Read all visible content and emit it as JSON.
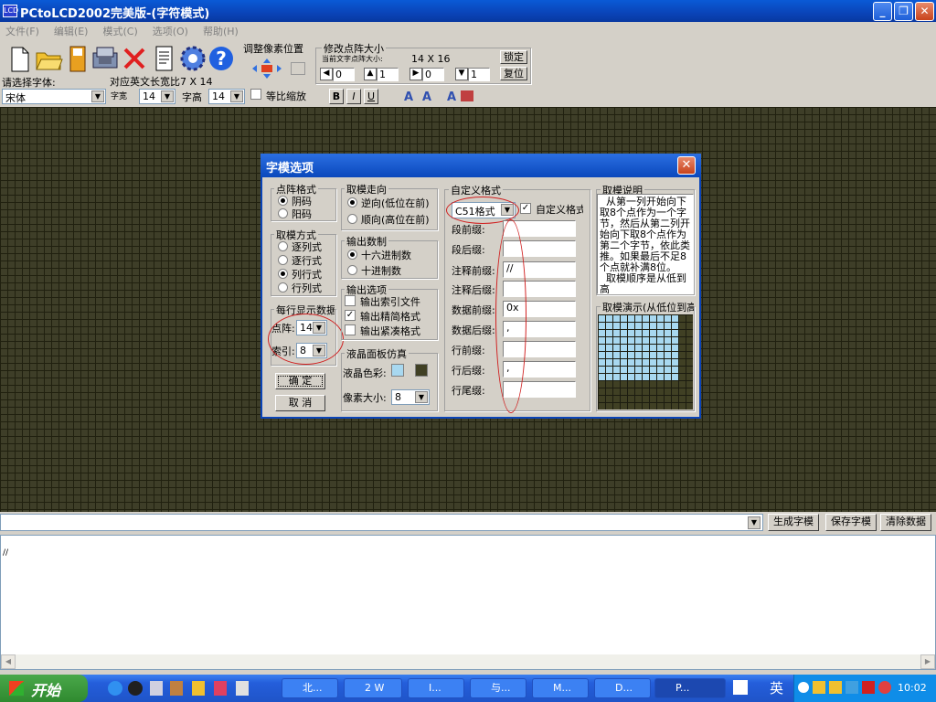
{
  "window": {
    "title": "PCtoLCD2002完美版-(字符模式)",
    "minimize": "_",
    "restore": "❐",
    "close": "✕"
  },
  "menu": [
    "文件(F)",
    "编辑(E)",
    "模式(C)",
    "选项(O)",
    "帮助(H)"
  ],
  "toolbar": {
    "adjust_pixel_label": "调整像素位置",
    "modify_size_label": "修改点阵大小",
    "current_size_label": "当前文字点阵大小:",
    "current_size_value": "14 X 16",
    "lock_button": "锁定",
    "reset_button": "复位",
    "spin1": "0",
    "spin2": "1",
    "spin3": "0",
    "spin4": "1",
    "font_select_label": "请选择字体:",
    "ratio_label": "对应英文长宽比7 X 14",
    "font_name": "宋体",
    "width_label": "字宽",
    "width_value": "14",
    "height_label": "字高",
    "height_value": "14",
    "proportional_label": "等比缩放",
    "bold": "B",
    "italic": "I",
    "underline": "U"
  },
  "dialog": {
    "title": "字模选项",
    "dot_format": {
      "title": "点阵格式",
      "options": [
        "阴码",
        "阳码"
      ],
      "selected": 0
    },
    "scan_mode": {
      "title": "取模方式",
      "options": [
        "逐列式",
        "逐行式",
        "列行式",
        "行列式"
      ],
      "selected": 2
    },
    "per_line": {
      "title": "每行显示数据",
      "dot_label": "点阵:",
      "dot_value": "14",
      "index_label": "索引:",
      "index_value": "8"
    },
    "ok": "确  定",
    "cancel": "取  消",
    "direction": {
      "title": "取模走向",
      "options": [
        "逆向(低位在前)",
        "顺向(高位在前)"
      ],
      "selected": 0
    },
    "radix": {
      "title": "输出数制",
      "options": [
        "十六进制数",
        "十进制数"
      ],
      "selected": 0
    },
    "output": {
      "title": "输出选项",
      "options": [
        "输出索引文件",
        "输出精简格式",
        "输出紧凑格式"
      ],
      "checked": [
        false,
        true,
        false
      ]
    },
    "lcd": {
      "title": "液晶面板仿真",
      "color_label": "液晶色彩:",
      "pixel_label": "像素大小:",
      "pixel_value": "8",
      "color_on": "#a8d8f0",
      "color_off": "#404024"
    },
    "custom": {
      "title": "自定义格式",
      "format_value": "C51格式",
      "custom_check_label": "自定义格式",
      "fields": [
        {
          "label": "段前缀:",
          "value": ""
        },
        {
          "label": "段后缀:",
          "value": ""
        },
        {
          "label": "注释前缀:",
          "value": "//"
        },
        {
          "label": "注释后缀:",
          "value": ""
        },
        {
          "label": "数据前缀:",
          "value": "0x"
        },
        {
          "label": "数据后缀:",
          "value": ","
        },
        {
          "label": "行前缀:",
          "value": ""
        },
        {
          "label": "行后缀:",
          "value": ","
        },
        {
          "label": "行尾缀:",
          "value": ""
        }
      ]
    },
    "description": {
      "title": "取模说明",
      "text": "  从第一列开始向下取8个点作为一个字节，然后从第二列开始向下取8个点作为第二个字节，依此类推。如果最后不足8个点就补满8位。\n  取模顺序是从低到高"
    },
    "demo": {
      "title": "取模演示(从低位到高位)"
    }
  },
  "bottom": {
    "generate": "生成字模",
    "save": "保存字模",
    "clear": "清除数据",
    "output_text": "//"
  },
  "taskbar": {
    "start": "开始",
    "tasks": [
      "北...",
      "2 W",
      "I...",
      "与...",
      "M...",
      "D...",
      "P..."
    ],
    "ime": "英",
    "time": "10:02"
  }
}
